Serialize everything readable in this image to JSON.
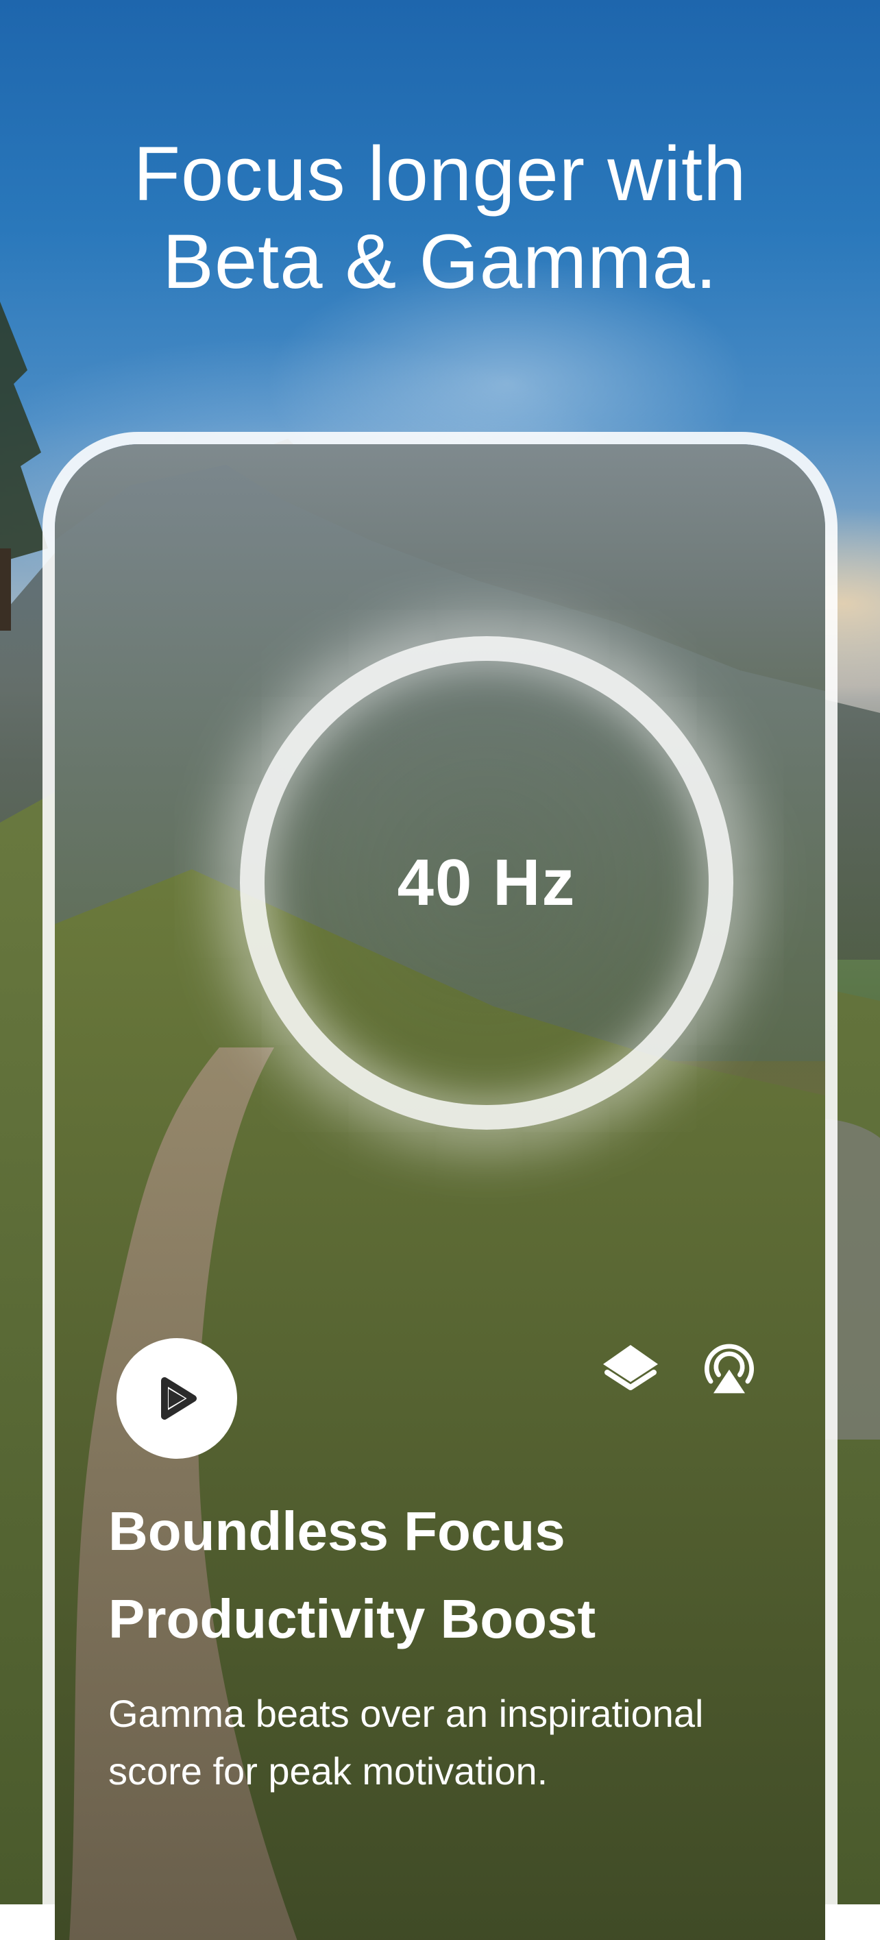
{
  "headline": {
    "line1": "Focus longer with",
    "line2": "Beta & Gamma."
  },
  "player": {
    "frequency": "40 Hz",
    "play_icon": "play-icon",
    "layers_icon": "layers-icon",
    "airplay_icon": "airplay-icon"
  },
  "track": {
    "title_line1": "Boundless Focus",
    "title_line2": "Productivity Boost",
    "description": "Gamma beats over an inspirational score for peak motivation."
  },
  "colors": {
    "sky": "#1e66ad",
    "text": "#ffffff",
    "play_button_bg": "#ffffff",
    "play_icon": "#2b2b2b"
  }
}
